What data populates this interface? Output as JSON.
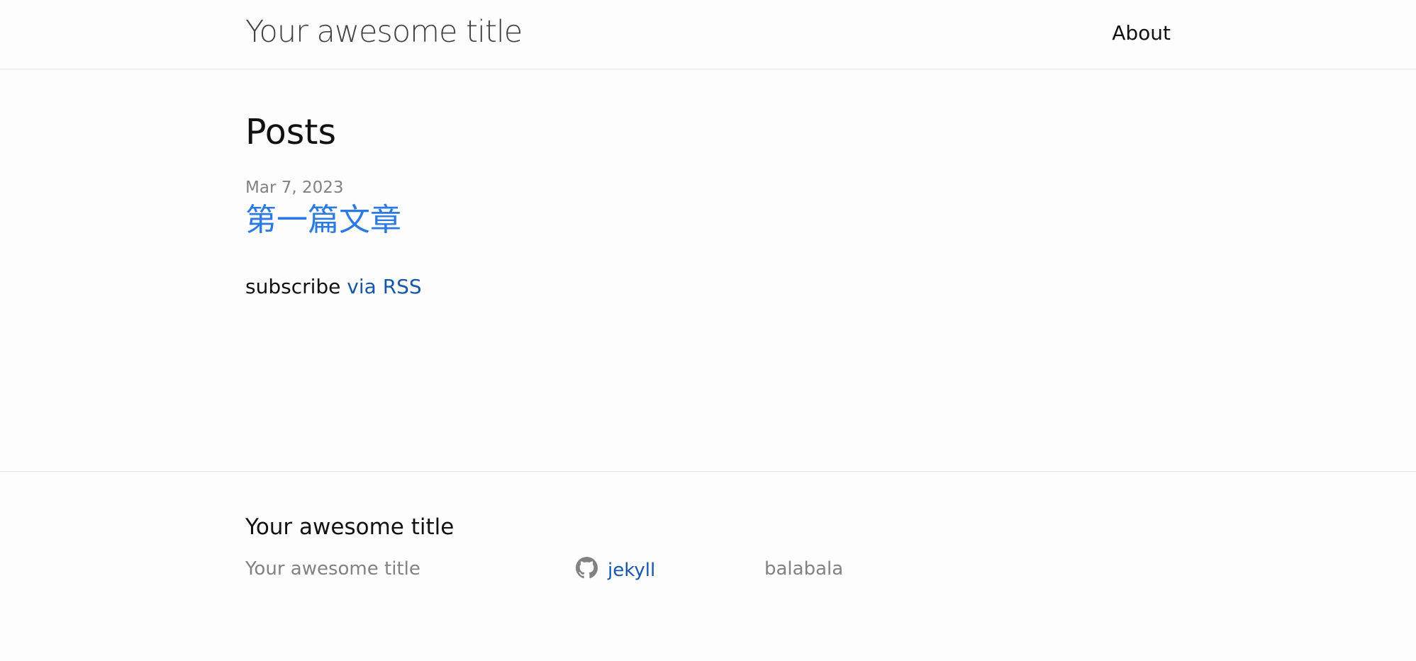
{
  "header": {
    "site_title": "Your awesome title",
    "nav": [
      {
        "label": "About"
      }
    ]
  },
  "main": {
    "heading": "Posts",
    "posts": [
      {
        "date": "Mar 7, 2023",
        "title": "第一篇文章"
      }
    ],
    "rss": {
      "prefix": "subscribe",
      "link_label": "via RSS"
    }
  },
  "footer": {
    "heading": "Your awesome title",
    "col1_text": "Your awesome title",
    "github": {
      "icon": "github-icon",
      "username": "jekyll"
    },
    "col3_text": "balabala"
  },
  "colors": {
    "link": "#2a7ae2",
    "link_dark": "#1756a9",
    "muted": "#828282",
    "text": "#111111",
    "background": "#fdfdfd",
    "border": "#e8e8e8"
  }
}
